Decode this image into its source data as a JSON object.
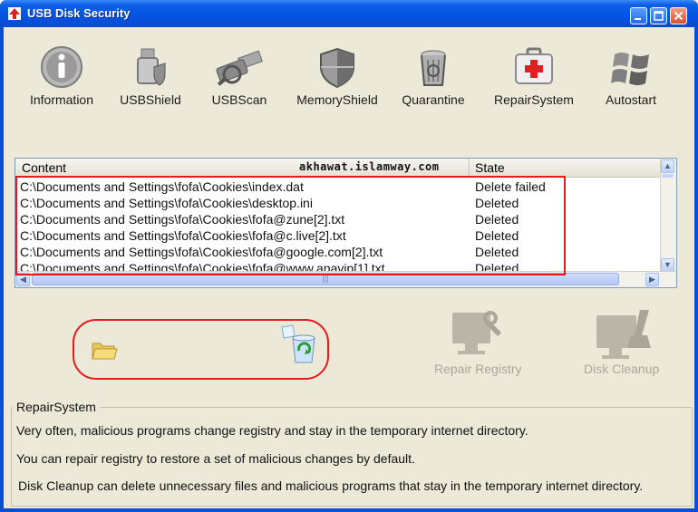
{
  "window": {
    "title": "USB Disk Security"
  },
  "toolbar": [
    {
      "label": "Information",
      "icon": "information-icon"
    },
    {
      "label": "USBShield",
      "icon": "usbshield-icon"
    },
    {
      "label": "USBScan",
      "icon": "usbscan-icon"
    },
    {
      "label": "MemoryShield",
      "icon": "memoryshield-icon"
    },
    {
      "label": "Quarantine",
      "icon": "quarantine-icon"
    },
    {
      "label": "RepairSystem",
      "icon": "repairsystem-icon"
    },
    {
      "label": "Autostart",
      "icon": "autostart-icon"
    }
  ],
  "list": {
    "columns": {
      "content": "Content",
      "state": "State"
    },
    "watermark": "akhawat.islamway.com",
    "rows": [
      {
        "content": "C:\\Documents and Settings\\fofa\\Cookies\\index.dat",
        "state": "Delete failed"
      },
      {
        "content": "C:\\Documents and Settings\\fofa\\Cookies\\desktop.ini",
        "state": "Deleted"
      },
      {
        "content": "C:\\Documents and Settings\\fofa\\Cookies\\fofa@zune[2].txt",
        "state": "Deleted"
      },
      {
        "content": "C:\\Documents and Settings\\fofa\\Cookies\\fofa@c.live[2].txt",
        "state": "Deleted"
      },
      {
        "content": "C:\\Documents and Settings\\fofa\\Cookies\\fofa@google.com[2].txt",
        "state": "Deleted"
      },
      {
        "content": "C:\\Documents and Settings\\fofa\\Cookies\\fofa@www.anavip[1].txt",
        "state": "Deleted"
      }
    ]
  },
  "actions": {
    "repair_registry": "Repair Registry",
    "disk_cleanup": "Disk Cleanup"
  },
  "info": {
    "title": "RepairSystem",
    "lines": [
      "Very often, malicious programs change registry and stay in the temporary internet directory.",
      "You can repair registry to restore a set of malicious changes by default.",
      "Disk Cleanup can delete unnecessary files and malicious programs that stay in the temporary internet directory."
    ]
  },
  "colors": {
    "title_bar": "#0453e2",
    "highlight": "#e81919",
    "client": "#ece9d8"
  }
}
